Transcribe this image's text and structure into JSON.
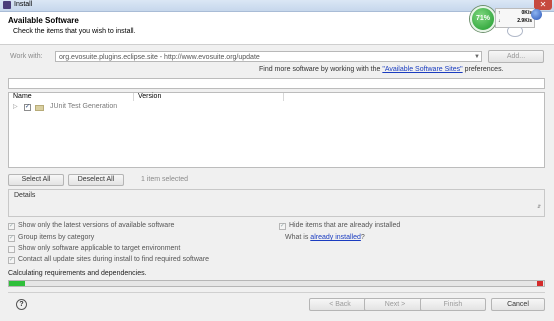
{
  "window": {
    "title": "Install",
    "close_glyph": "✕"
  },
  "header": {
    "title": "Available Software",
    "subtitle": "Check the items that you wish to install."
  },
  "widget": {
    "percent": "71%",
    "up": {
      "arrow": "↑",
      "value": "0K/s"
    },
    "down": {
      "arrow": "↓",
      "value": "2.9K/s"
    }
  },
  "site": {
    "work_with_label": "Work with:",
    "url": "org.evosuite.plugins.eclipse.site - http://www.evosuite.org/update",
    "add_label": "Add...",
    "find_more_prefix": "Find more software by working with the ",
    "find_more_link": "\"Available Software Sites\"",
    "find_more_suffix": " preferences."
  },
  "table": {
    "col_name": "Name",
    "col_version": "Version",
    "rows": [
      {
        "label": "JUnit Test Generation",
        "checked": true,
        "expander": "▷"
      }
    ]
  },
  "actions": {
    "select_all": "Select All",
    "deselect_all": "Deselect All",
    "selected_count": "1 item selected"
  },
  "details": {
    "label": "Details"
  },
  "options": {
    "latest_versions": "Show only the latest versions of available software",
    "group_by_category": "Group items by category",
    "applicable_only": "Show only software applicable to target environment",
    "contact_sites": "Contact all update sites during install to find required software",
    "hide_installed": "Hide items that are already installed",
    "what_is_prefix": "What is ",
    "what_is_link": "already installed",
    "what_is_suffix": "?"
  },
  "status": {
    "message": "Calculating requirements and dependencies.",
    "progress": 0.03
  },
  "footer": {
    "help_glyph": "?",
    "back": "< Back",
    "next": "Next >",
    "finish": "Finish",
    "cancel": "Cancel"
  },
  "colors": {
    "progress": "#2fbf3a",
    "link": "#1a3cc0",
    "gauge": "#1e9a2c"
  }
}
